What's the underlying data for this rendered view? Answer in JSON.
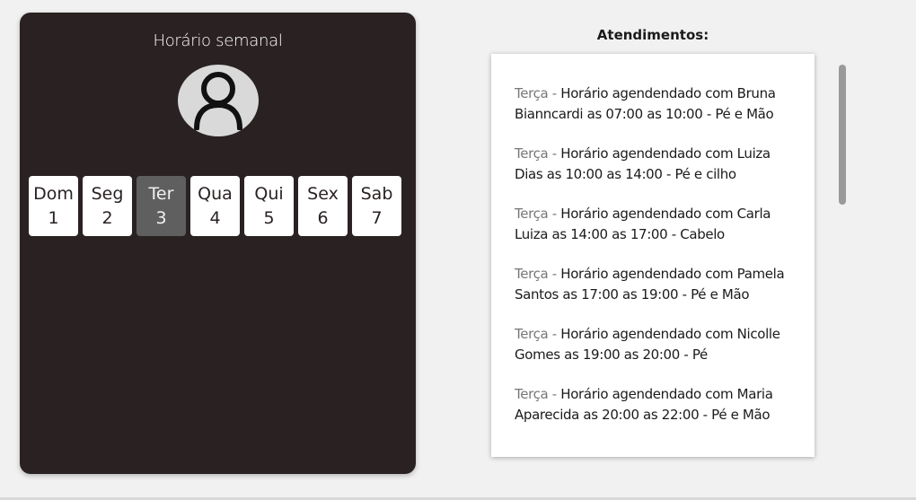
{
  "weekly": {
    "title": "Horário semanal",
    "days": [
      {
        "label": "Dom",
        "number": "1"
      },
      {
        "label": "Seg",
        "number": "2"
      },
      {
        "label": "Ter",
        "number": "3"
      },
      {
        "label": "Qua",
        "number": "4"
      },
      {
        "label": "Qui",
        "number": "5"
      },
      {
        "label": "Sex",
        "number": "6"
      },
      {
        "label": "Sab",
        "number": "7"
      }
    ],
    "selected_day": "Ter",
    "avatar_icon": "user-icon"
  },
  "appointments": {
    "title": "Atendimentos:",
    "items": [
      {
        "day": "Terça",
        "sep": " - ",
        "text": "Horário agendendado com Bruna Bianncardi as 07:00 as 10:00 - Pé e Mão"
      },
      {
        "day": "Terça",
        "sep": " - ",
        "text": "Horário agendendado com Luiza Dias as 10:00 as 14:00 - Pé e cilho"
      },
      {
        "day": "Terça",
        "sep": " - ",
        "text": "Horário agendendado com Carla Luiza as 14:00 as 17:00 - Cabelo"
      },
      {
        "day": "Terça",
        "sep": " - ",
        "text": "Horário agendendado com Pamela Santos as 17:00 as 19:00 - Pé e Mão"
      },
      {
        "day": "Terça",
        "sep": " - ",
        "text": "Horário agendendado com Nicolle Gomes as 19:00 as 20:00 - Pé"
      },
      {
        "day": "Terça",
        "sep": " - ",
        "text": "Horário agendendado com Maria Aparecida as 20:00 as 22:00 - Pé e Mão"
      }
    ]
  },
  "colors": {
    "card_bg": "#2a2222",
    "selected_day_bg": "#5f5f5f",
    "day_name_color": "#777777"
  }
}
